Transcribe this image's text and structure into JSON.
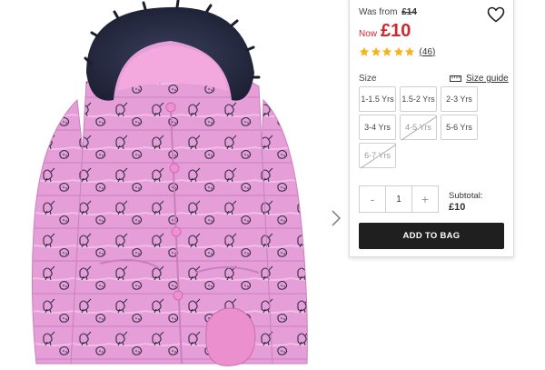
{
  "product": {
    "image_alt": "Pink unicorn print puffer coat with faux fur hood",
    "price": {
      "was_label": "Was from",
      "was_price": "£14",
      "now_label": "Now",
      "now_price": "£10"
    },
    "rating": {
      "stars": 5,
      "max_stars": 5,
      "review_count": "(46)"
    }
  },
  "size": {
    "label": "Size",
    "guide_label": "Size guide",
    "options": [
      {
        "label": "1-1.5 Yrs",
        "available": true
      },
      {
        "label": "1.5-2 Yrs",
        "available": true
      },
      {
        "label": "2-3 Yrs",
        "available": true
      },
      {
        "label": "3-4 Yrs",
        "available": true
      },
      {
        "label": "4-5 Yrs",
        "available": false
      },
      {
        "label": "5-6 Yrs",
        "available": true
      },
      {
        "label": "6-7 Yrs",
        "available": false
      }
    ]
  },
  "quantity": {
    "minus": "-",
    "value": "1",
    "plus": "+"
  },
  "subtotal": {
    "label": "Subtotal:",
    "value": "£10"
  },
  "actions": {
    "add_to_bag": "ADD TO BAG"
  },
  "icons": {
    "wishlist": "heart-icon",
    "next_image": "chevron-right-icon",
    "size_guide": "ruler-icon",
    "rating": "star-icon"
  },
  "colors": {
    "price_red": "#d1282e",
    "star_yellow": "#f6b418",
    "button_dark": "#1f1f1f",
    "coat_pink": "#e79fd9",
    "hood_fur": "#2a2e47"
  }
}
